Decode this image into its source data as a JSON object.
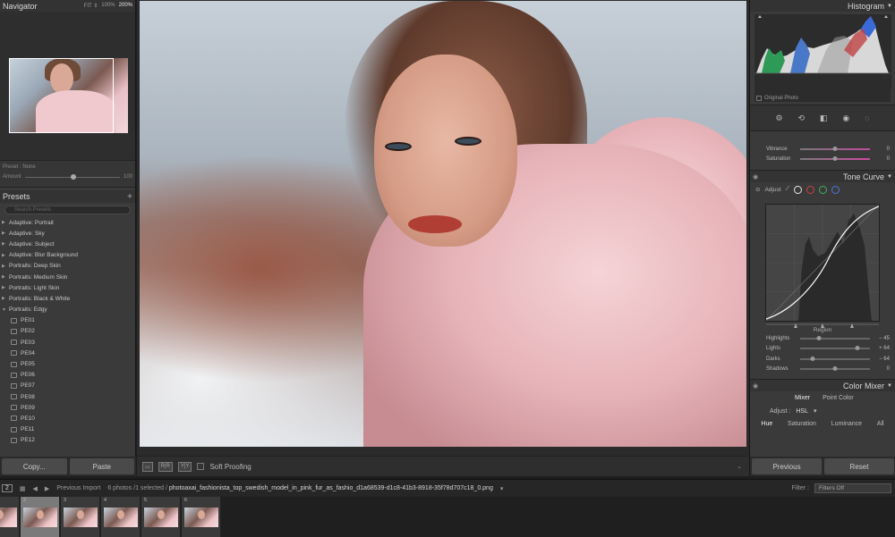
{
  "left": {
    "navigator": {
      "title": "Navigator",
      "zoom_options": [
        "FIT ⇕",
        "100%",
        "200%"
      ],
      "selected_zoom": "200%"
    },
    "preset_amount": {
      "label": "Preset : None",
      "amount_label": "Amount",
      "amount_value": "100",
      "amount_pct": 0.48
    },
    "presets": {
      "title": "Presets",
      "search_placeholder": "Search Presets",
      "groups": [
        "Adaptive: Portrait",
        "Adaptive: Sky",
        "Adaptive: Subject",
        "Adaptive: Blur Background",
        "Portraits: Deep Skin",
        "Portraits: Medium Skin",
        "Portraits: Light Skin",
        "Portraits: Black & White",
        "Portraits: Edgy"
      ],
      "items": [
        "PE01",
        "PE02",
        "PE03",
        "PE04",
        "PE05",
        "PE06",
        "PE07",
        "PE08",
        "PE09",
        "PE10",
        "PE11",
        "PE12"
      ]
    },
    "buttons": {
      "copy": "Copy...",
      "paste": "Paste"
    }
  },
  "toolbar": {
    "view_loupe": "▭",
    "view_compare": "R|R",
    "view_survey": "Y|Y",
    "soft_proofing": "Soft Proofing"
  },
  "right": {
    "histogram": {
      "title": "Histogram",
      "original_photo": "Original Photo"
    },
    "tools": [
      "⚙",
      "⟲",
      "◧",
      "◉",
      "◌"
    ],
    "presence": [
      {
        "name": "Vibrance",
        "value": "0",
        "pct": 0.5
      },
      {
        "name": "Saturation",
        "value": "0",
        "pct": 0.5
      }
    ],
    "tone_curve": {
      "title": "Tone Curve",
      "adjust_label": "Adjust",
      "region_label": "Region",
      "sliders": [
        {
          "name": "Highlights",
          "value": "− 45",
          "pct": 0.27
        },
        {
          "name": "Lights",
          "value": "+ 64",
          "pct": 0.82
        },
        {
          "name": "Darks",
          "value": "− 64",
          "pct": 0.18
        },
        {
          "name": "Shadows",
          "value": "0",
          "pct": 0.5
        }
      ]
    },
    "color_mixer": {
      "title": "Color Mixer",
      "tabs": [
        "Mixer",
        "Point Color"
      ],
      "adjust_label": "Adjust :",
      "adjust_value": "HSL",
      "subtabs": [
        "Hue",
        "Saturation",
        "Luminance",
        "All"
      ]
    },
    "buttons": {
      "previous": "Previous",
      "reset": "Reset"
    }
  },
  "filmbar": {
    "screen_num": "2",
    "source": "Previous Import",
    "count": "6 photos /1 selected /",
    "filename": "photoaxai_fashionista_top_swedish_model_in_pink_fur_as_fashio_d1a68539-d1c8-41b3-8918-35f78d707c18_0.png",
    "filter_label": "Filter :",
    "filter_value": "Filters Off"
  },
  "filmstrip": {
    "cells": [
      "1",
      "2",
      "3",
      "4",
      "5",
      "6"
    ],
    "selected": "2"
  }
}
